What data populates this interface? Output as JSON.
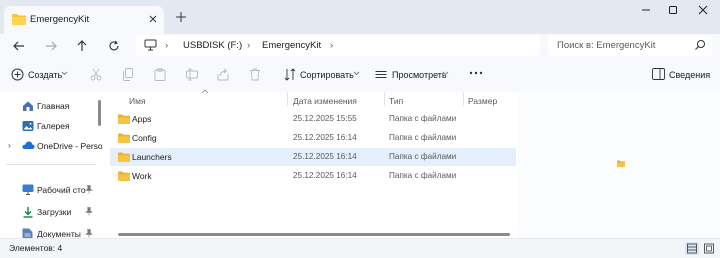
{
  "window": {
    "tab_title": "EmergencyKit"
  },
  "address": {
    "crumbs": [
      "USBDISK (F:)",
      "EmergencyKit"
    ],
    "search_placeholder": "Поиск в: EmergencyKit"
  },
  "toolbar": {
    "create_label": "Создать",
    "sort_label": "Сортировать",
    "view_label": "Просмотреть",
    "details_label": "Сведения"
  },
  "sidebar": {
    "items": [
      {
        "label": "Главная",
        "icon": "home-icon"
      },
      {
        "label": "Галерея",
        "icon": "gallery-icon"
      },
      {
        "label": "OneDrive - Perso",
        "icon": "onedrive-icon"
      },
      {
        "label": "Рабочий сто",
        "icon": "desktop-icon"
      },
      {
        "label": "Загрузки",
        "icon": "download-icon"
      },
      {
        "label": "Документы",
        "icon": "documents-icon"
      }
    ]
  },
  "file_list": {
    "columns": [
      "Имя",
      "Дата изменения",
      "Тип",
      "Размер"
    ],
    "rows": [
      {
        "name": "Apps",
        "date": "25.12.2025 15:55",
        "type": "Папка с файлами",
        "selected": false
      },
      {
        "name": "Config",
        "date": "25.12.2025 16:14",
        "type": "Папка с файлами",
        "selected": false
      },
      {
        "name": "Launchers",
        "date": "25.12.2025 16:14",
        "type": "Папка с файлами",
        "selected": true
      },
      {
        "name": "Work",
        "date": "25.12.2025 16:14",
        "type": "Папка с файлами",
        "selected": false
      }
    ]
  },
  "status": {
    "items_count": "Элементов: 4"
  },
  "colors": {
    "folder": "#f6c343",
    "accent": "#0067c0",
    "selection": "#e5effb"
  }
}
